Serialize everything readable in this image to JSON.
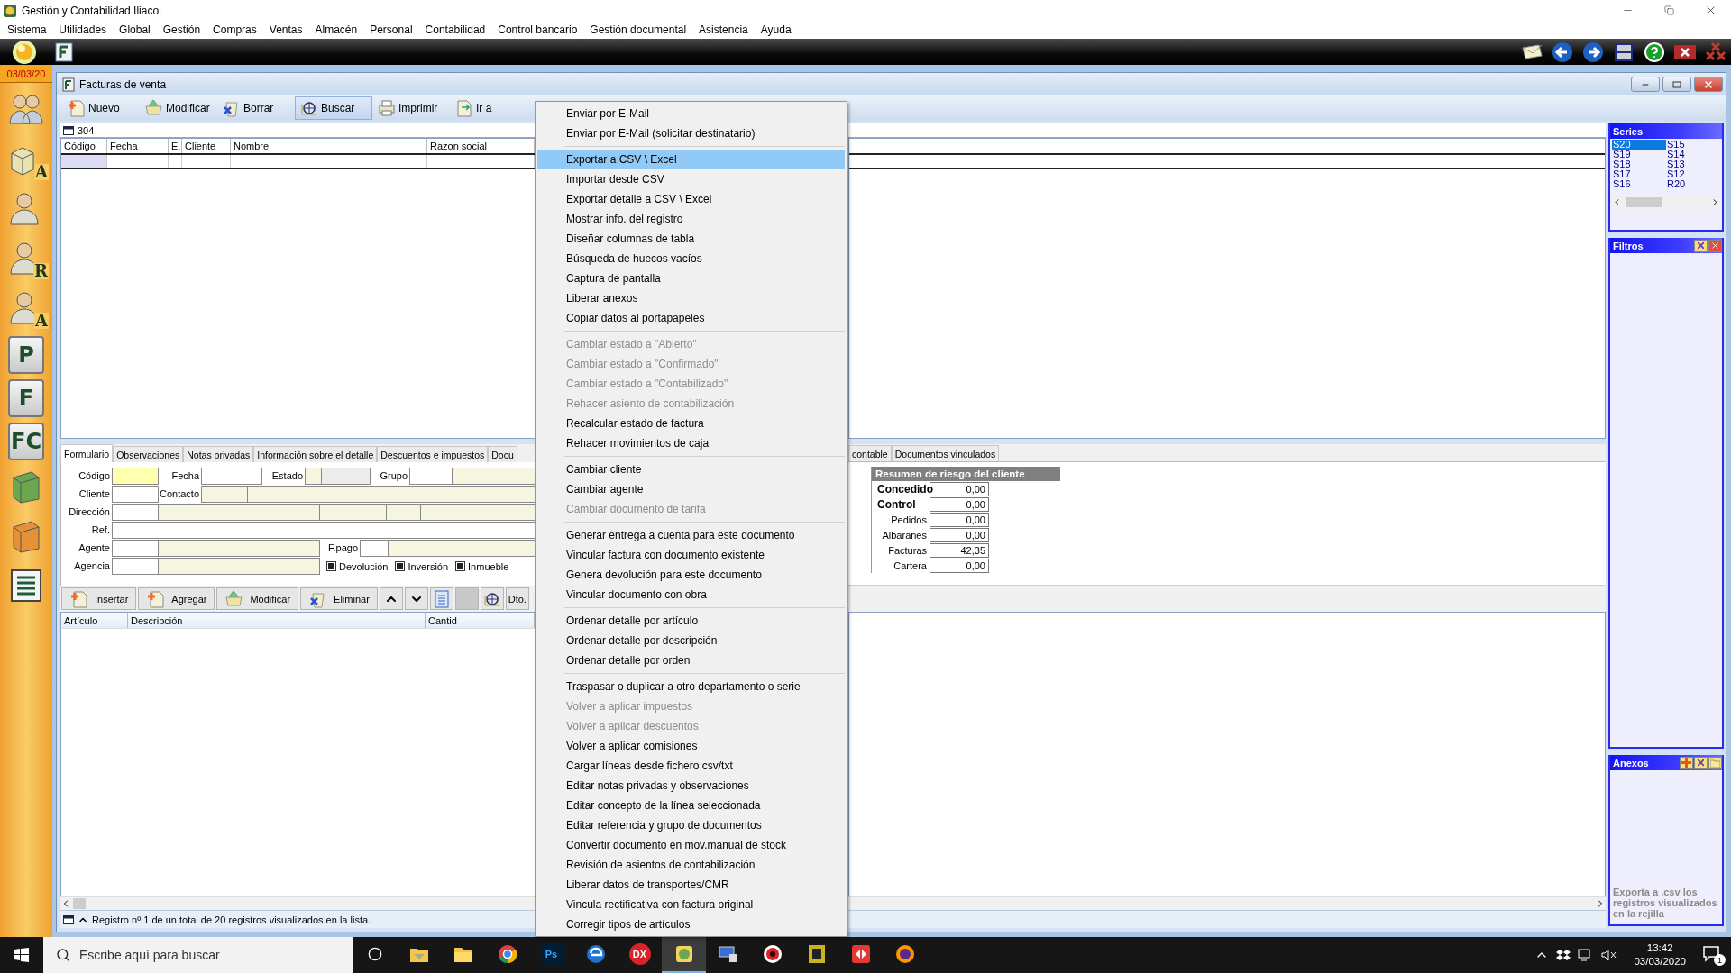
{
  "app": {
    "title": "Gestión y Contabilidad Iliaco."
  },
  "menu_bar": [
    "Sistema",
    "Utilidades",
    "Global",
    "Gestión",
    "Compras",
    "Ventas",
    "Almacén",
    "Personal",
    "Contabilidad",
    "Control bancario",
    "Gestión documental",
    "Asistencia",
    "Ayuda"
  ],
  "date_badge": "03/03/20",
  "sidebar_items": [
    {
      "kind": "people"
    },
    {
      "kind": "boxes",
      "letter": "A"
    },
    {
      "kind": "person"
    },
    {
      "kind": "person",
      "letter": "R"
    },
    {
      "kind": "person",
      "letter": "A"
    },
    {
      "kind": "tile",
      "letter": "P"
    },
    {
      "kind": "tile",
      "letter": "F"
    },
    {
      "kind": "tile",
      "letter": "FC"
    },
    {
      "kind": "book",
      "color": "#6aa84f"
    },
    {
      "kind": "book",
      "color": "#e69138"
    },
    {
      "kind": "list"
    }
  ],
  "window": {
    "title": "Facturas de venta"
  },
  "toolbar": [
    {
      "kind": "new",
      "label": "Nuevo",
      "selected": false
    },
    {
      "kind": "edit",
      "label": "Modificar",
      "selected": false
    },
    {
      "kind": "delete",
      "label": "Borrar",
      "selected": false
    },
    {
      "kind": "search",
      "label": "Buscar",
      "selected": true
    },
    {
      "kind": "print",
      "label": "Imprimir",
      "selected": false
    },
    {
      "kind": "goto",
      "label": "Ir a",
      "selected": false
    }
  ],
  "record_count": "304",
  "grid": {
    "columns": [
      "Código",
      "Fecha",
      "E.",
      "Cliente",
      "Nombre",
      "Razon social"
    ]
  },
  "tabs_left": [
    {
      "label": "Formulario",
      "selected": true
    },
    {
      "label": "Observaciones",
      "selected": false
    },
    {
      "label": "Notas privadas",
      "selected": false
    },
    {
      "label": "Información sobre el detalle",
      "selected": false
    },
    {
      "label": "Descuentos e impuestos",
      "selected": false
    },
    {
      "label": "Docu",
      "selected": false
    }
  ],
  "tabs_right": [
    {
      "label": "contable",
      "selected": false
    },
    {
      "label": "Documentos vinculados",
      "selected": false
    }
  ],
  "form": {
    "rows": [
      {
        "cells": [
          {
            "kind": "label",
            "text": "Código"
          },
          {
            "kind": "field",
            "required": true,
            "readonly": false,
            "disabled": false
          },
          {
            "kind": "label",
            "text": "Fecha"
          },
          {
            "kind": "field",
            "required": false,
            "readonly": false,
            "disabled": false
          },
          {
            "kind": "label",
            "text": "Estado"
          },
          {
            "kind": "field",
            "required": false,
            "readonly": true,
            "disabled": false
          },
          {
            "kind": "field",
            "required": false,
            "readonly": false,
            "disabled": true
          },
          {
            "kind": "label",
            "text": "Grupo"
          },
          {
            "kind": "field",
            "required": false,
            "readonly": false,
            "disabled": false
          },
          {
            "kind": "field",
            "required": false,
            "readonly": true,
            "disabled": false
          }
        ]
      },
      {
        "cells": [
          {
            "kind": "label",
            "text": "Cliente"
          },
          {
            "kind": "field",
            "required": false,
            "readonly": false,
            "disabled": false
          },
          {
            "kind": "label",
            "text": "Contacto"
          },
          {
            "kind": "field",
            "required": false,
            "readonly": true,
            "disabled": false
          },
          {
            "kind": "field",
            "required": false,
            "readonly": true,
            "disabled": false
          }
        ]
      },
      {
        "cells": [
          {
            "kind": "label",
            "text": "Dirección"
          },
          {
            "kind": "field",
            "required": false,
            "readonly": false,
            "disabled": false
          },
          {
            "kind": "field",
            "required": false,
            "readonly": true,
            "disabled": false
          },
          {
            "kind": "field",
            "required": false,
            "readonly": true,
            "disabled": false
          },
          {
            "kind": "field",
            "required": false,
            "readonly": true,
            "disabled": false
          },
          {
            "kind": "field",
            "required": false,
            "readonly": true,
            "disabled": false
          }
        ]
      },
      {
        "cells": [
          {
            "kind": "label",
            "text": "Ref."
          },
          {
            "kind": "field",
            "required": false,
            "readonly": false,
            "disabled": false
          }
        ]
      },
      {
        "cells": [
          {
            "kind": "label",
            "text": "Agente"
          },
          {
            "kind": "field",
            "required": false,
            "readonly": false,
            "disabled": false
          },
          {
            "kind": "field",
            "required": false,
            "readonly": true,
            "disabled": false
          },
          {
            "kind": "label",
            "text": "F.pago"
          },
          {
            "kind": "field",
            "required": false,
            "readonly": false,
            "disabled": false
          },
          {
            "kind": "field",
            "required": false,
            "readonly": true,
            "disabled": false
          }
        ]
      },
      {
        "cells": [
          {
            "kind": "label",
            "text": "Agencia"
          },
          {
            "kind": "field",
            "required": false,
            "readonly": false,
            "disabled": false
          },
          {
            "kind": "field",
            "required": false,
            "readonly": true,
            "disabled": false
          },
          {
            "kind": "checkbox",
            "text": "Devolución",
            "checked": true
          },
          {
            "kind": "checkbox",
            "text": "Inversión",
            "checked": true
          },
          {
            "kind": "checkbox",
            "text": "Inmueble",
            "checked": true
          }
        ]
      }
    ]
  },
  "risk_summary": {
    "title": "Resumen de riesgo del cliente",
    "rows": [
      {
        "label": "Concedido",
        "value": "0,00",
        "bold": true
      },
      {
        "label": "Control",
        "value": "0,00",
        "bold": true
      },
      {
        "label": "Pedidos",
        "value": "0,00",
        "bold": false
      },
      {
        "label": "Albaranes",
        "value": "0,00",
        "bold": false
      },
      {
        "label": "Facturas",
        "value": "42,35",
        "bold": false
      },
      {
        "label": "Cartera",
        "value": "0,00",
        "bold": false
      }
    ]
  },
  "detail_toolbar": [
    {
      "kind": "insert",
      "label": "Insertar"
    },
    {
      "kind": "add",
      "label": "Agregar"
    },
    {
      "kind": "edit",
      "label": "Modificar"
    },
    {
      "kind": "delete",
      "label": "Eliminar"
    },
    {
      "kind": "up"
    },
    {
      "kind": "down"
    },
    {
      "kind": "document"
    },
    {
      "kind": "blank"
    },
    {
      "kind": "target"
    },
    {
      "kind": "text",
      "label": "Dto."
    }
  ],
  "detail_grid": {
    "columns": [
      "Artículo",
      "Descripción",
      "Cantid"
    ]
  },
  "status": "Registro nº 1 de un total de 20 registros visualizados en la lista.",
  "series": {
    "title": "Series",
    "items": [
      {
        "label": "S20",
        "selected": true
      },
      {
        "label": "S15",
        "selected": false
      },
      {
        "label": "S19",
        "selected": false
      },
      {
        "label": "S14",
        "selected": false
      },
      {
        "label": "S18",
        "selected": false
      },
      {
        "label": "S13",
        "selected": false
      },
      {
        "label": "S17",
        "selected": false
      },
      {
        "label": "S12",
        "selected": false
      },
      {
        "label": "S16",
        "selected": false
      },
      {
        "label": "R20",
        "selected": false
      }
    ]
  },
  "filters": {
    "title": "Filtros"
  },
  "attachments": {
    "title": "Anexos",
    "hint": "Exporta a .csv los registros visualizados en la rejilla"
  },
  "context_menu": [
    {
      "kind": "item",
      "label": "Enviar por E-Mail",
      "disabled": false,
      "selected": false
    },
    {
      "kind": "item",
      "label": "Enviar por E-Mail (solicitar destinatario)",
      "disabled": false,
      "selected": false
    },
    {
      "kind": "separator"
    },
    {
      "kind": "item",
      "label": "Exportar a CSV \\ Excel",
      "disabled": false,
      "selected": true
    },
    {
      "kind": "item",
      "label": "Importar desde CSV",
      "disabled": false,
      "selected": false
    },
    {
      "kind": "item",
      "label": "Exportar detalle a CSV \\ Excel",
      "disabled": false,
      "selected": false
    },
    {
      "kind": "item",
      "label": "Mostrar info. del registro",
      "disabled": false,
      "selected": false
    },
    {
      "kind": "item",
      "label": "Diseñar columnas de tabla",
      "disabled": false,
      "selected": false
    },
    {
      "kind": "item",
      "label": "Búsqueda de huecos vacíos",
      "disabled": false,
      "selected": false
    },
    {
      "kind": "item",
      "label": "Captura de pantalla",
      "disabled": false,
      "selected": false
    },
    {
      "kind": "item",
      "label": "Liberar anexos",
      "disabled": false,
      "selected": false
    },
    {
      "kind": "item",
      "label": "Copiar datos al portapapeles",
      "disabled": false,
      "selected": false
    },
    {
      "kind": "separator"
    },
    {
      "kind": "item",
      "label": "Cambiar estado a \"Abierto\"",
      "disabled": true,
      "selected": false
    },
    {
      "kind": "item",
      "label": "Cambiar estado a \"Confirmado\"",
      "disabled": true,
      "selected": false
    },
    {
      "kind": "item",
      "label": "Cambiar estado a \"Contabilizado\"",
      "disabled": true,
      "selected": false
    },
    {
      "kind": "item",
      "label": "Rehacer asiento de contabilización",
      "disabled": true,
      "selected": false
    },
    {
      "kind": "item",
      "label": "Recalcular estado de factura",
      "disabled": false,
      "selected": false
    },
    {
      "kind": "item",
      "label": "Rehacer movimientos de caja",
      "disabled": false,
      "selected": false
    },
    {
      "kind": "separator"
    },
    {
      "kind": "item",
      "label": "Cambiar cliente",
      "disabled": false,
      "selected": false
    },
    {
      "kind": "item",
      "label": "Cambiar agente",
      "disabled": false,
      "selected": false
    },
    {
      "kind": "item",
      "label": "Cambiar documento de tarifa",
      "disabled": true,
      "selected": false
    },
    {
      "kind": "separator"
    },
    {
      "kind": "item",
      "label": "Generar entrega a cuenta para este documento",
      "disabled": false,
      "selected": false
    },
    {
      "kind": "item",
      "label": "Vincular factura con documento existente",
      "disabled": false,
      "selected": false
    },
    {
      "kind": "item",
      "label": "Genera devolución para este documento",
      "disabled": false,
      "selected": false
    },
    {
      "kind": "item",
      "label": "Vincular documento con obra",
      "disabled": false,
      "selected": false
    },
    {
      "kind": "separator"
    },
    {
      "kind": "item",
      "label": "Ordenar detalle por artículo",
      "disabled": false,
      "selected": false
    },
    {
      "kind": "item",
      "label": "Ordenar detalle por descripción",
      "disabled": false,
      "selected": false
    },
    {
      "kind": "item",
      "label": "Ordenar detalle por orden",
      "disabled": false,
      "selected": false
    },
    {
      "kind": "separator"
    },
    {
      "kind": "item",
      "label": "Traspasar  o duplicar a otro departamento o serie",
      "disabled": false,
      "selected": false
    },
    {
      "kind": "item",
      "label": "Volver a aplicar impuestos",
      "disabled": true,
      "selected": false
    },
    {
      "kind": "item",
      "label": "Volver a aplicar descuentos",
      "disabled": true,
      "selected": false
    },
    {
      "kind": "item",
      "label": "Volver a aplicar comisiones",
      "disabled": false,
      "selected": false
    },
    {
      "kind": "item",
      "label": "Cargar líneas desde fichero csv/txt",
      "disabled": false,
      "selected": false
    },
    {
      "kind": "item",
      "label": "Editar notas privadas y observaciones",
      "disabled": false,
      "selected": false
    },
    {
      "kind": "item",
      "label": "Editar concepto de la línea seleccionada",
      "disabled": false,
      "selected": false
    },
    {
      "kind": "item",
      "label": "Editar referencia y grupo de documentos",
      "disabled": false,
      "selected": false
    },
    {
      "kind": "item",
      "label": "Convertir documento en mov.manual de stock",
      "disabled": false,
      "selected": false
    },
    {
      "kind": "item",
      "label": "Revisión de asientos de contabilización",
      "disabled": false,
      "selected": false
    },
    {
      "kind": "item",
      "label": "Liberar datos de transportes/CMR",
      "disabled": false,
      "selected": false
    },
    {
      "kind": "item",
      "label": "Vincula rectificativa con factura original",
      "disabled": false,
      "selected": false
    },
    {
      "kind": "item",
      "label": "Corregir tipos de artículos",
      "disabled": false,
      "selected": false
    }
  ],
  "taskbar": {
    "search_placeholder": "Escribe aquí para buscar",
    "apps": [
      {
        "kind": "folder-app",
        "active": false
      },
      {
        "kind": "explorer",
        "active": false
      },
      {
        "kind": "chrome",
        "active": false
      },
      {
        "kind": "badge",
        "label": "Ps",
        "active": false
      },
      {
        "kind": "edge",
        "active": false
      },
      {
        "kind": "round-badge",
        "label": "DX",
        "active": false
      },
      {
        "kind": "ledger",
        "active": true
      },
      {
        "kind": "computer",
        "active": false
      },
      {
        "kind": "shield",
        "active": false
      },
      {
        "kind": "yellow-app",
        "active": false
      },
      {
        "kind": "arrows",
        "active": false
      },
      {
        "kind": "firefox",
        "active": false
      }
    ],
    "time": "13:42",
    "date": "03/03/2020",
    "notifications": "1"
  }
}
